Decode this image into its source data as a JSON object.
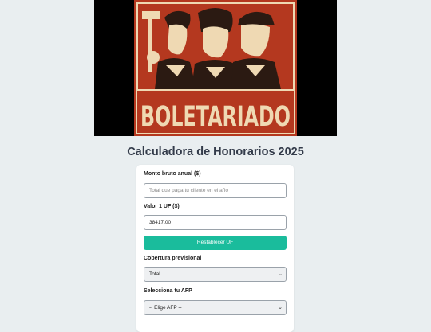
{
  "hero": {
    "poster_text": "BOLETARIADO"
  },
  "page": {
    "title": "Calculadora de Honorarios 2025"
  },
  "form": {
    "monto_label": "Monto bruto anual ($)",
    "monto_placeholder": "Total que paga tu cliente en el año",
    "monto_value": "",
    "uf_label": "Valor 1 UF ($)",
    "uf_value": "38417.00",
    "reset_uf_label": "Restablecer UF",
    "cobertura_label": "Cobertura previsional",
    "cobertura_selected": "Total",
    "afp_label": "Selecciona tu AFP",
    "afp_selected": "-- Elige AFP --"
  },
  "colors": {
    "accent": "#1abc9c",
    "poster_red": "#b4381f",
    "poster_cream": "#efd9b3",
    "background": "#e9eef0"
  }
}
